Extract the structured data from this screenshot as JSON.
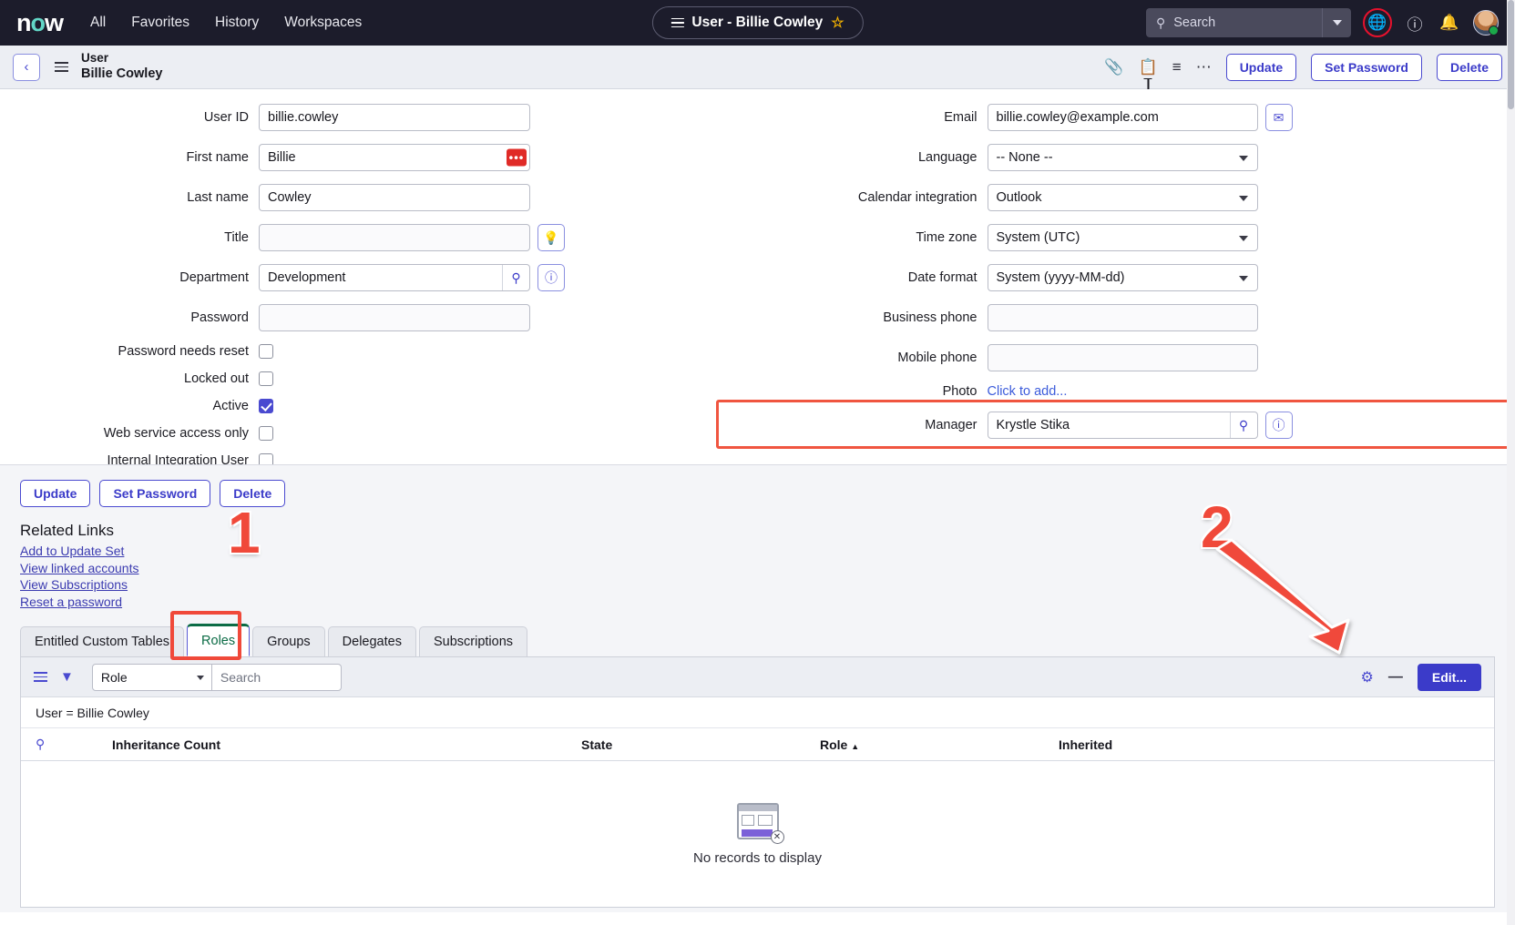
{
  "topnav": {
    "logo": "now",
    "links": [
      "All",
      "Favorites",
      "History",
      "Workspaces"
    ],
    "title_pill": "User - Billie Cowley",
    "star_glyph": "☆",
    "search_placeholder": "Search",
    "icons": {
      "search": "search-icon",
      "globe": "globe-icon",
      "help": "help-icon",
      "bell": "notification-bell-icon",
      "avatar": "user-avatar"
    },
    "globe_highlight_color": "#e8112d"
  },
  "formbar": {
    "back_glyph": "‹",
    "record_type": "User",
    "record_name": "Billie Cowley",
    "icons": {
      "attachment": "paperclip-icon",
      "update_set": "clipboard-add-icon",
      "personalize": "sliders-icon",
      "more": "ellipsis-icon"
    },
    "buttons": [
      "Update",
      "Set Password",
      "Delete"
    ]
  },
  "form": {
    "left": [
      {
        "label": "User ID",
        "type": "text",
        "value": "billie.cowley"
      },
      {
        "label": "First name",
        "type": "text",
        "value": "Billie",
        "badge": "•••"
      },
      {
        "label": "Last name",
        "type": "text",
        "value": "Cowley"
      },
      {
        "label": "Title",
        "type": "text",
        "value": "",
        "side_button": "lightbulb-icon"
      },
      {
        "label": "Department",
        "type": "reference",
        "value": "Development",
        "side_button": "info-icon"
      },
      {
        "label": "Password",
        "type": "text",
        "value": ""
      },
      {
        "label": "Password needs reset",
        "type": "checkbox",
        "checked": false
      },
      {
        "label": "Locked out",
        "type": "checkbox",
        "checked": false
      },
      {
        "label": "Active",
        "type": "checkbox",
        "checked": true
      },
      {
        "label": "Web service access only",
        "type": "checkbox",
        "checked": false
      },
      {
        "label": "Internal Integration User",
        "type": "checkbox",
        "checked": false
      }
    ],
    "right": [
      {
        "label": "Email",
        "type": "text",
        "value": "billie.cowley@example.com",
        "side_button": "envelope-icon"
      },
      {
        "label": "Language",
        "type": "select",
        "value": "-- None --"
      },
      {
        "label": "Calendar integration",
        "type": "select",
        "value": "Outlook"
      },
      {
        "label": "Time zone",
        "type": "select",
        "value": "System (UTC)"
      },
      {
        "label": "Date format",
        "type": "select",
        "value": "System (yyyy-MM-dd)"
      },
      {
        "label": "Business phone",
        "type": "text",
        "value": ""
      },
      {
        "label": "Mobile phone",
        "type": "text",
        "value": ""
      },
      {
        "label": "Photo",
        "type": "link",
        "value": "Click to add..."
      },
      {
        "label": "Manager",
        "type": "reference",
        "value": "Krystle Stika",
        "side_button": "info-icon",
        "highlighted": true
      }
    ],
    "highlight_color": "#f05540"
  },
  "lower": {
    "buttons": [
      "Update",
      "Set Password",
      "Delete"
    ],
    "related_links_title": "Related Links",
    "related_links": [
      "Add to Update Set",
      "View linked accounts",
      "View Subscriptions",
      "Reset a password"
    ],
    "tabs": [
      {
        "label": "Entitled Custom Tables",
        "active": false
      },
      {
        "label": "Roles",
        "active": true
      },
      {
        "label": "Groups",
        "active": false
      },
      {
        "label": "Delegates",
        "active": false
      },
      {
        "label": "Subscriptions",
        "active": false
      }
    ],
    "list_toolbar": {
      "menu_icon": "list-menu-icon",
      "filter_icon": "funnel-filter-icon",
      "field_select": "Role",
      "search_placeholder": "Search",
      "gear_icon": "gear-icon",
      "collapse_glyph": "—",
      "edit_label": "Edit..."
    },
    "breadcrumb": "User = Billie Cowley",
    "table": {
      "search_col_icon": "column-search-icon",
      "columns": [
        "Inheritance Count",
        "State",
        "Role",
        "Inherited"
      ],
      "sort_column": "Role",
      "sort_glyph": "▲",
      "rows": [],
      "empty_message": "No records to display",
      "empty_icon": "no-records-icon"
    }
  },
  "annotations": [
    {
      "number": "1",
      "target": "roles-tab"
    },
    {
      "number": "2",
      "target": "edit-button"
    }
  ]
}
